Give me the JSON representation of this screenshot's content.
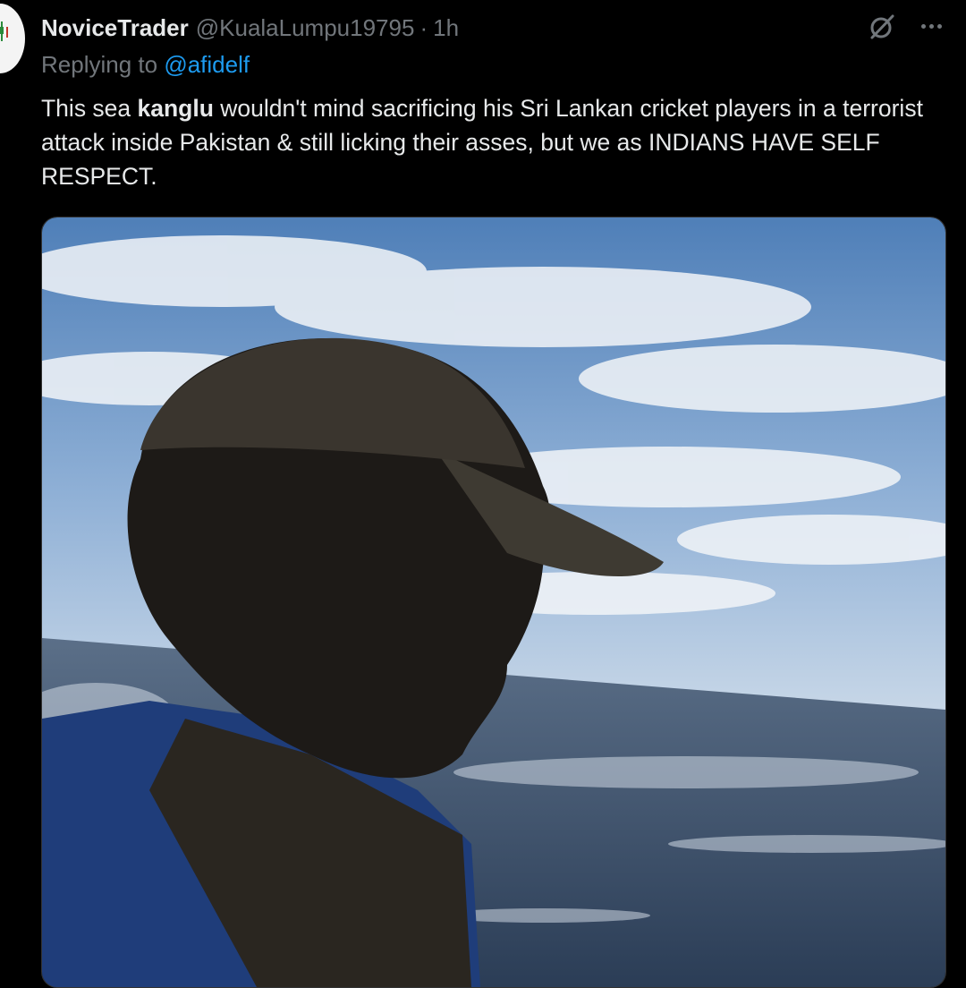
{
  "tweet": {
    "display_name": "NoviceTrader",
    "handle": "@KualaLumpu19795",
    "separator": "·",
    "time": "1h",
    "replying_prefix": "Replying to ",
    "replying_to": "@afidelf",
    "text_before": "This sea ",
    "text_bold": "kanglu",
    "text_after": " wouldn't mind sacrificing his Sri Lankan cricket players in a terrorist attack inside Pakistan & still licking their asses, but we as INDIANS HAVE SELF RESPECT."
  },
  "icons": {
    "grok": "grok-icon",
    "more": "more-icon"
  },
  "colors": {
    "background": "#000000",
    "text": "#e7e9ea",
    "muted": "#71767b",
    "link": "#1d9bf0"
  }
}
